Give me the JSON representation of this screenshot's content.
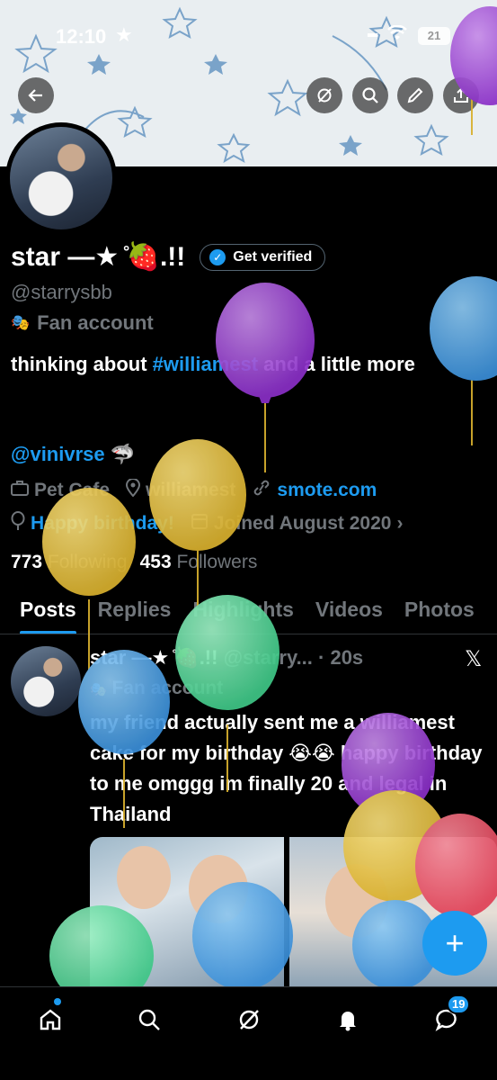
{
  "status_bar": {
    "time": "12:10",
    "battery": "21"
  },
  "profile": {
    "name": "star —★ ̊🍓.!!",
    "verify_label": "Get verified",
    "handle": "@starrysbb",
    "category": "Fan account",
    "bio_line_prefix": "thinking about ",
    "bio_hashtag": "#williamest",
    "bio_suffix": " and a little more",
    "mention": "@vinivrse 🦈",
    "meta": {
      "category_tag": "Pet Cafe",
      "location": "williamest",
      "website": "smote.com",
      "birthday": "Happy birthday!",
      "joined": "Joined August 2020"
    },
    "following_count": "773",
    "following_label": "Following",
    "followers_count": "453",
    "followers_label": "Followers"
  },
  "tabs": [
    "Posts",
    "Replies",
    "Highlights",
    "Videos",
    "Photos"
  ],
  "post": {
    "name": "star —★ ̊🍓.!!",
    "handle_time": "@starry... · 20s",
    "category": "Fan account",
    "text": "my friend actually sent me a williamest cake for my birthday 😭😭 happy birthday to me omggg im finally 20 and legal in Thailand"
  },
  "nav": {
    "messages_badge": "19"
  },
  "colors": {
    "accent": "#1d9bf0",
    "background": "#000000",
    "muted": "#71767b"
  }
}
